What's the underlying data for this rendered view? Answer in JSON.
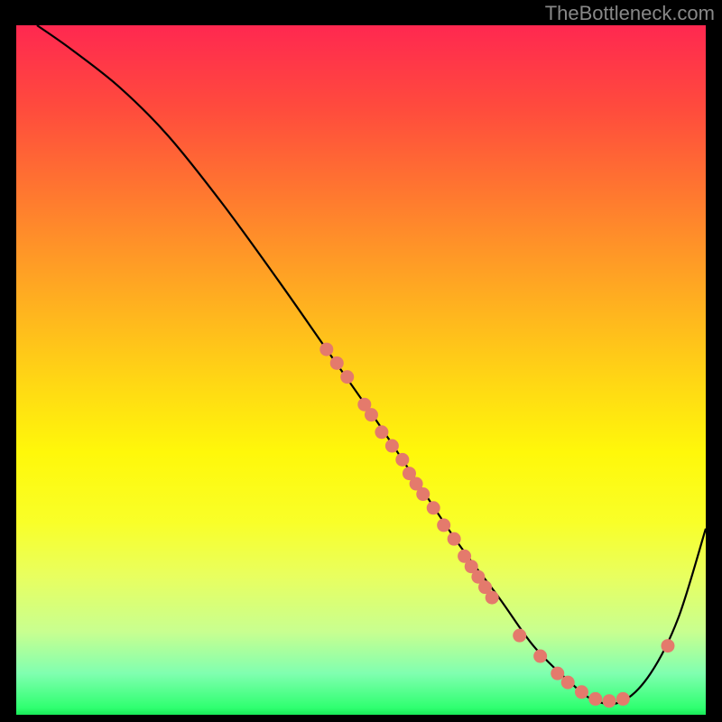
{
  "watermark": "TheBottleneck.com",
  "chart_data": {
    "type": "line",
    "title": "",
    "xlabel": "",
    "ylabel": "",
    "xlim": [
      0,
      100
    ],
    "ylim": [
      0,
      100
    ],
    "background": "red-yellow-green vertical gradient (bottleneck heatmap)",
    "series": [
      {
        "name": "bottleneck-curve",
        "x": [
          3,
          8,
          15,
          22,
          30,
          38,
          45,
          52,
          58,
          64,
          70,
          75,
          80,
          84,
          88,
          92,
          96,
          100
        ],
        "y": [
          100,
          96.5,
          91,
          84,
          74,
          63,
          53,
          43,
          34,
          25,
          17,
          10,
          5,
          2,
          2,
          6,
          14,
          27
        ]
      }
    ],
    "points": [
      {
        "name": "cluster-mid",
        "x": 45,
        "y": 53
      },
      {
        "name": "cluster-mid",
        "x": 46.5,
        "y": 51
      },
      {
        "name": "cluster-mid",
        "x": 48,
        "y": 49
      },
      {
        "name": "cluster-mid",
        "x": 50.5,
        "y": 45
      },
      {
        "name": "cluster-mid",
        "x": 51.5,
        "y": 43.5
      },
      {
        "name": "cluster-mid",
        "x": 53,
        "y": 41
      },
      {
        "name": "cluster-mid",
        "x": 54.5,
        "y": 39
      },
      {
        "name": "cluster-mid",
        "x": 56,
        "y": 37
      },
      {
        "name": "cluster-mid",
        "x": 57,
        "y": 35
      },
      {
        "name": "cluster-mid",
        "x": 58,
        "y": 33.5
      },
      {
        "name": "cluster-mid",
        "x": 59,
        "y": 32
      },
      {
        "name": "cluster-mid",
        "x": 60.5,
        "y": 30
      },
      {
        "name": "cluster-mid",
        "x": 62,
        "y": 27.5
      },
      {
        "name": "cluster-mid",
        "x": 63.5,
        "y": 25.5
      },
      {
        "name": "cluster-mid",
        "x": 65,
        "y": 23
      },
      {
        "name": "cluster-mid",
        "x": 66,
        "y": 21.5
      },
      {
        "name": "cluster-mid",
        "x": 67,
        "y": 20
      },
      {
        "name": "cluster-mid",
        "x": 68,
        "y": 18.5
      },
      {
        "name": "cluster-mid",
        "x": 69,
        "y": 17
      },
      {
        "name": "cluster-low",
        "x": 73,
        "y": 11.5
      },
      {
        "name": "cluster-low",
        "x": 76,
        "y": 8.5
      },
      {
        "name": "cluster-low",
        "x": 78.5,
        "y": 6
      },
      {
        "name": "cluster-low",
        "x": 80,
        "y": 4.7
      },
      {
        "name": "cluster-low",
        "x": 82,
        "y": 3.3
      },
      {
        "name": "cluster-low",
        "x": 84,
        "y": 2.3
      },
      {
        "name": "cluster-low",
        "x": 86,
        "y": 2
      },
      {
        "name": "cluster-low",
        "x": 88,
        "y": 2.3
      },
      {
        "name": "cluster-right",
        "x": 94.5,
        "y": 10
      }
    ],
    "dot_radius_default": 7.5
  }
}
